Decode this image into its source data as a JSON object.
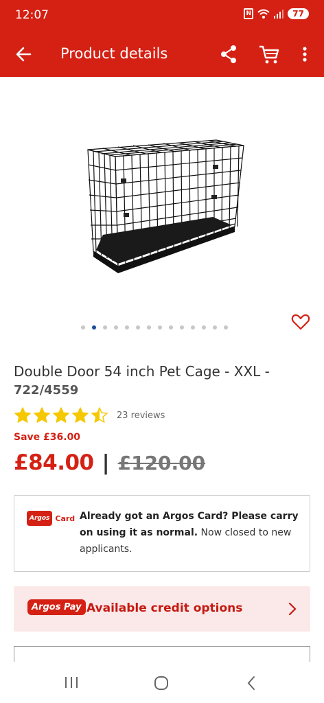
{
  "status_bar": {
    "time": "12:07",
    "battery": "77"
  },
  "app_bar": {
    "title": "Product details"
  },
  "product": {
    "title": "Double Door 54 inch Pet Cage - XXL - ",
    "code": "722/4559",
    "rating": 4.5,
    "reviews": "23 reviews",
    "save_text": "Save £36.00",
    "price": "£84.00",
    "separator": "|",
    "old_price": "£120.00",
    "image_count": 14,
    "active_image": 2
  },
  "argos_card": {
    "logo_badge": "Argos",
    "logo_text": "Card",
    "bold_text": "Already got an Argos Card? Please carry on using it as normal.",
    "normal_text": " Now closed to new applicants."
  },
  "credit": {
    "badge": "Argos Pay",
    "text": "Available credit options"
  },
  "colors": {
    "brand_red": "#d42114",
    "star_yellow": "#f5c800",
    "dot_active": "#1a4b9c"
  }
}
